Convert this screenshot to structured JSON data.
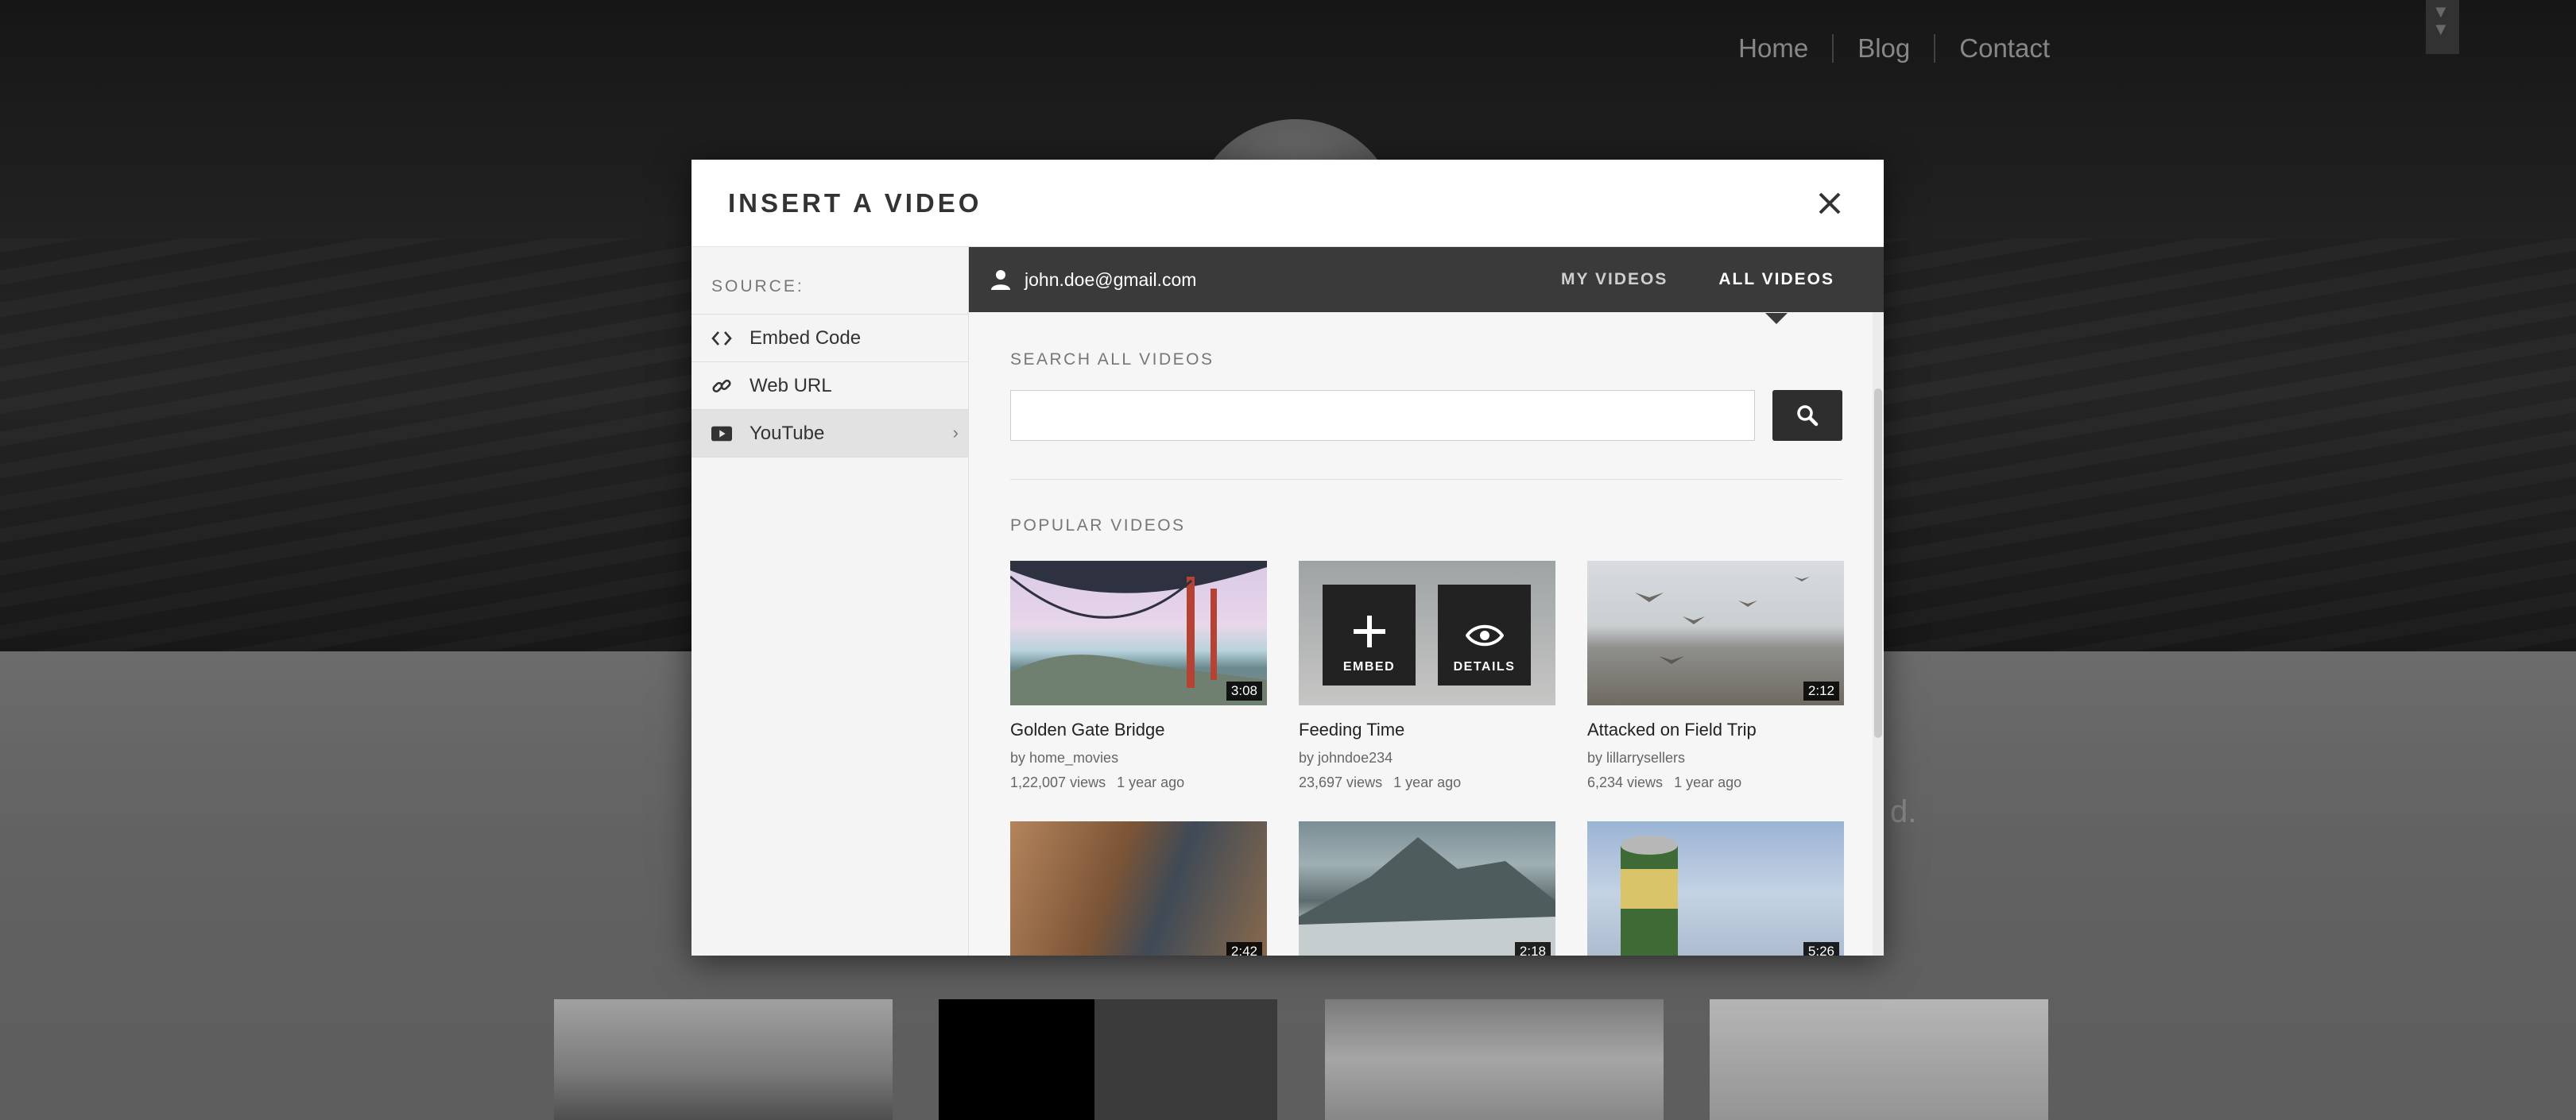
{
  "background_page": {
    "nav": [
      "Home",
      "Blog",
      "Contact"
    ],
    "fragment": "d."
  },
  "modal": {
    "title": "INSERT A VIDEO",
    "close_icon": "close-icon",
    "sidebar": {
      "heading": "SOURCE:",
      "items": [
        {
          "label": "Embed Code",
          "icon": "code-icon",
          "active": false
        },
        {
          "label": "Web URL",
          "icon": "link-icon",
          "active": false
        },
        {
          "label": "YouTube",
          "icon": "youtube-icon",
          "active": true
        }
      ]
    },
    "account": {
      "email": "john.doe@gmail.com"
    },
    "tabs": [
      {
        "label": "MY VIDEOS",
        "active": false
      },
      {
        "label": "ALL VIDEOS",
        "active": true
      }
    ],
    "search": {
      "label": "SEARCH ALL VIDEOS",
      "value": "",
      "placeholder": ""
    },
    "popular": {
      "label": "POPULAR VIDEOS",
      "hover_actions": {
        "embed": "EMBED",
        "details": "DETAILS"
      },
      "videos": [
        {
          "title": "Golden Gate Bridge",
          "by": "by home_movies",
          "views": "1,22,007 views",
          "age": "1 year ago",
          "duration": "3:08"
        },
        {
          "title": "Feeding Time",
          "by": "by johndoe234",
          "views": "23,697 views",
          "age": "1 year ago",
          "duration": ""
        },
        {
          "title": "Attacked on Field Trip",
          "by": "by lillarrysellers",
          "views": "6,234 views",
          "age": "1 year ago",
          "duration": "2:12"
        },
        {
          "title": "",
          "by": "",
          "views": "",
          "age": "",
          "duration": "2:42"
        },
        {
          "title": "",
          "by": "",
          "views": "",
          "age": "",
          "duration": "2:18"
        },
        {
          "title": "",
          "by": "",
          "views": "",
          "age": "",
          "duration": "5:26"
        }
      ]
    }
  },
  "colors": {
    "panel_bar": "#3a3a3a",
    "search_button": "#2e2e2e",
    "sidebar": "#f4f4f4"
  }
}
